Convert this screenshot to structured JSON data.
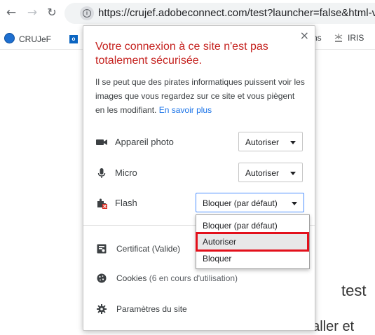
{
  "browser": {
    "url": "https://crujef.adobeconnect.com/test?launcher=false&html-v",
    "bookmarks": [
      {
        "label": "CRUJeF"
      },
      {
        "label": "ns"
      },
      {
        "label": "IRIS"
      }
    ]
  },
  "popup": {
    "close_glyph": "×",
    "warning_title": "Votre connexion à ce site n'est pas totalement sécurisée.",
    "warning_body": "Il se peut que des pirates informatiques puissent voir les images que vous regardez sur ce site et vous piègent en les modifiant.",
    "learn_more": "En savoir plus",
    "permissions": [
      {
        "label": "Appareil photo",
        "value": "Autoriser",
        "icon": "camera-icon"
      },
      {
        "label": "Micro",
        "value": "Autoriser",
        "icon": "microphone-icon"
      },
      {
        "label": "Flash",
        "value": "Bloquer (par défaut)",
        "icon": "plugin-icon"
      }
    ],
    "certificate_label": "Certificat",
    "certificate_status": "(Valide)",
    "cookies_label": "Cookies",
    "cookies_status": "(6 en cours d'utilisation)",
    "site_settings_label": "Paramètres du site"
  },
  "dropdown": {
    "options": [
      "Bloquer (par défaut)",
      "Autoriser",
      "Bloquer"
    ],
    "highlighted": "Autoriser"
  },
  "page": {
    "heading": "test",
    "text": "Vous devez installer et"
  },
  "colors": {
    "warning": "#c5221f",
    "link": "#1a73e8",
    "highlight_box": "#e3101b"
  }
}
